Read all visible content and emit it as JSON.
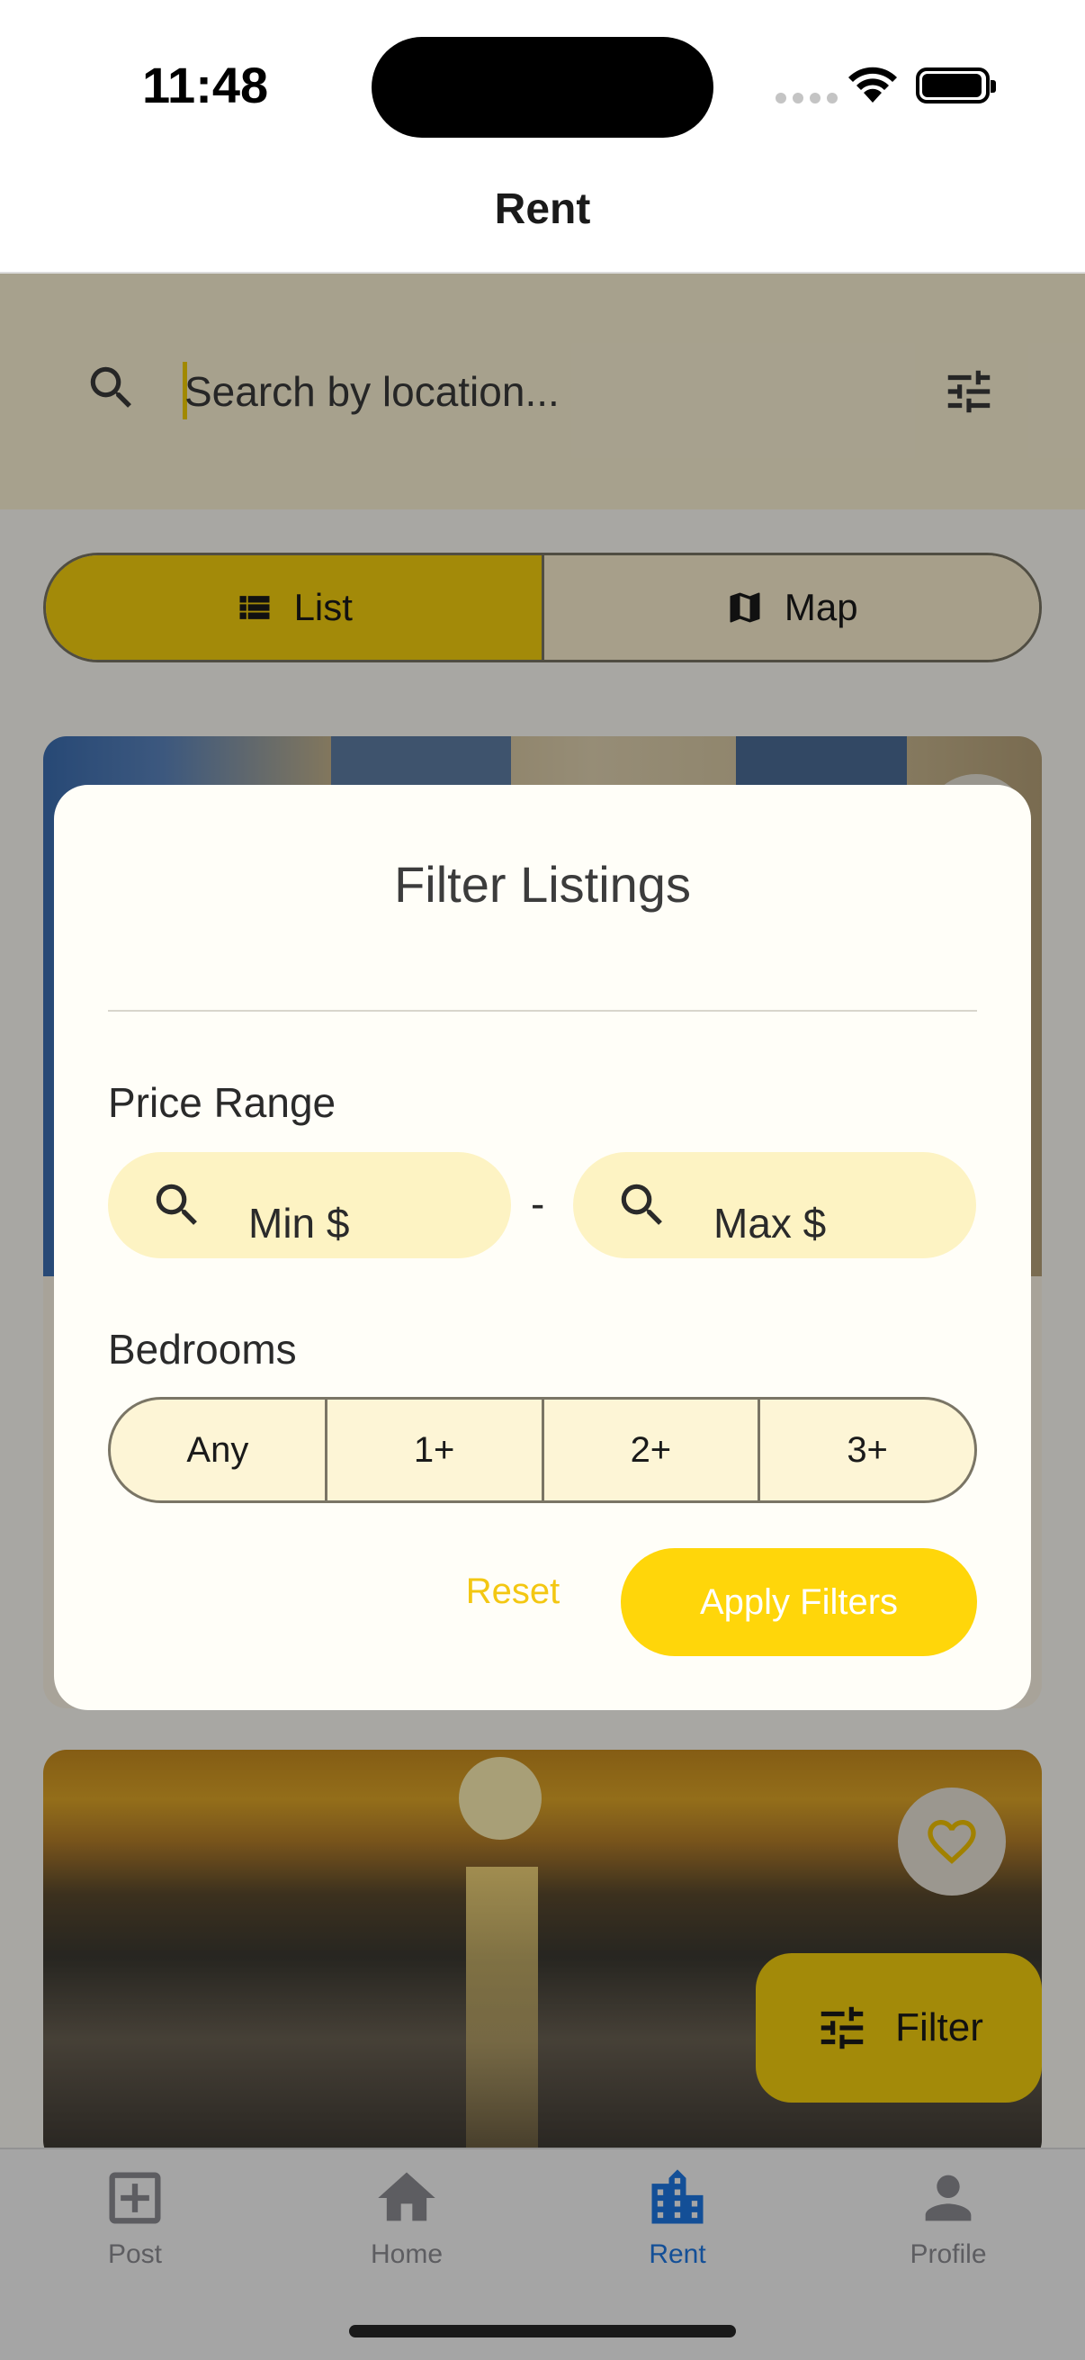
{
  "status_bar": {
    "time": "11:48"
  },
  "header": {
    "title": "Rent"
  },
  "search": {
    "placeholder": "Search by location...",
    "value": ""
  },
  "view_toggle": {
    "list_label": "List",
    "map_label": "Map",
    "selected": "List"
  },
  "listings": [
    {
      "favorite": false
    },
    {
      "favorite": false
    }
  ],
  "fab": {
    "label": "Filter"
  },
  "filter_dialog": {
    "title": "Filter Listings",
    "price_range_label": "Price Range",
    "min_placeholder": "Min $",
    "separator": "-",
    "max_placeholder": "Max $",
    "bedrooms_label": "Bedrooms",
    "bedroom_options": [
      "Any",
      "1+",
      "2+",
      "3+"
    ],
    "reset_label": "Reset",
    "apply_label": "Apply Filters"
  },
  "tab_bar": {
    "tabs": [
      {
        "label": "Post",
        "icon": "add-box-icon"
      },
      {
        "label": "Home",
        "icon": "home-icon"
      },
      {
        "label": "Rent",
        "icon": "building-icon"
      },
      {
        "label": "Profile",
        "icon": "person-icon"
      }
    ],
    "active": "Rent"
  },
  "colors": {
    "accent": "#F8D20E",
    "apply_button": "#FFD60A",
    "field_bg": "#FDF3C3",
    "active_tab": "#1E78E6",
    "inactive_tab": "#8E8E93"
  }
}
